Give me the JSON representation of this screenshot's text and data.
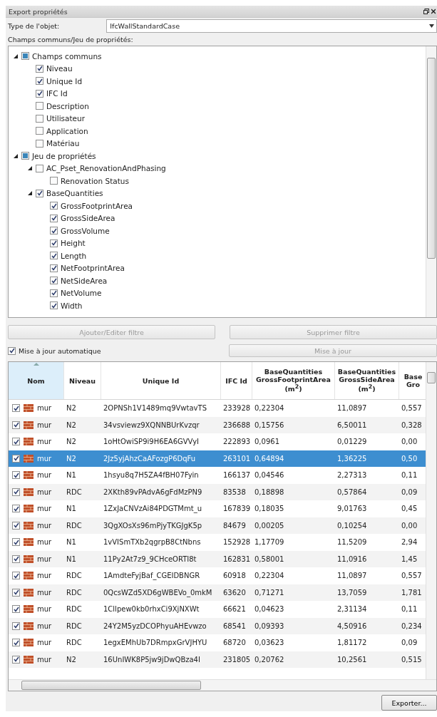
{
  "panel": {
    "title": "Export propriétés"
  },
  "object_type": {
    "label": "Type de l'objet:",
    "value": "IfcWallStandardCase"
  },
  "tree_label": "Champs communs/Jeu de propriétés:",
  "tree": [
    {
      "label": "Champs communs",
      "checked": false,
      "indeterminate": true,
      "expanded": true,
      "children": [
        {
          "label": "Niveau",
          "checked": true
        },
        {
          "label": "Unique Id",
          "checked": true
        },
        {
          "label": "IFC Id",
          "checked": true
        },
        {
          "label": "Description",
          "checked": false
        },
        {
          "label": "Utilisateur",
          "checked": false
        },
        {
          "label": "Application",
          "checked": false
        },
        {
          "label": "Matériau",
          "checked": false
        }
      ]
    },
    {
      "label": "Jeu de propriétés",
      "checked": false,
      "indeterminate": true,
      "expanded": true,
      "children": [
        {
          "label": "AC_Pset_RenovationAndPhasing",
          "checked": false,
          "indeterminate": false,
          "expanded": true,
          "children": [
            {
              "label": "Renovation Status",
              "checked": false
            }
          ]
        },
        {
          "label": "BaseQuantities",
          "checked": true,
          "indeterminate": false,
          "expanded": true,
          "children": [
            {
              "label": "GrossFootprintArea",
              "checked": true
            },
            {
              "label": "GrossSideArea",
              "checked": true
            },
            {
              "label": "GrossVolume",
              "checked": true
            },
            {
              "label": "Height",
              "checked": true
            },
            {
              "label": "Length",
              "checked": true
            },
            {
              "label": "NetFootprintArea",
              "checked": true
            },
            {
              "label": "NetSideArea",
              "checked": true
            },
            {
              "label": "NetVolume",
              "checked": true
            },
            {
              "label": "Width",
              "checked": true
            }
          ]
        }
      ]
    }
  ],
  "filter_buttons": [
    {
      "label": "Ajouter/Editer filtre",
      "disabled": true
    },
    {
      "label": "Supprimer filtre",
      "disabled": true
    }
  ],
  "auto_update": {
    "label": "Mise à jour automatique",
    "checked": true
  },
  "update_button": {
    "label": "Mise à jour",
    "disabled": true
  },
  "table": {
    "columns": [
      {
        "lines": [
          "Nom"
        ],
        "sorted": true
      },
      {
        "lines": [
          "Niveau"
        ],
        "sorted": false
      },
      {
        "lines": [
          "Unique Id"
        ],
        "sorted": false
      },
      {
        "lines": [
          "IFC Id"
        ],
        "sorted": false
      },
      {
        "lines": [
          "BaseQuantities",
          "GrossFootprintArea",
          "(m$^{2}$)"
        ],
        "sorted": false
      },
      {
        "lines": [
          "BaseQuantities",
          "GrossSideArea",
          "(m$^{2}$)"
        ],
        "sorted": false
      },
      {
        "lines": [
          "Base",
          "Gro"
        ],
        "sorted": false
      }
    ],
    "rows": [
      {
        "checked": true,
        "selected": false,
        "cells": [
          "mur",
          "N2",
          "2OPNSh1V1489mq9VwtavTS",
          "233928",
          "0,22304",
          "11,0897",
          "0,557"
        ]
      },
      {
        "checked": true,
        "selected": false,
        "cells": [
          "mur",
          "N2",
          "34vsviewz9XQNNBUrKvzqr",
          "236688",
          "0,15756",
          "6,50011",
          "0,328"
        ]
      },
      {
        "checked": true,
        "selected": false,
        "cells": [
          "mur",
          "N2",
          "1oHtOwiSP9i9H6EA6GVVyI",
          "222893",
          "0,0961",
          "0,01229",
          "0,00"
        ]
      },
      {
        "checked": true,
        "selected": true,
        "cells": [
          "mur",
          "N2",
          "2Jz5yjAhzCaAFozgP6DqFu",
          "263101",
          "0,64894",
          "1,36225",
          "0,50"
        ]
      },
      {
        "checked": true,
        "selected": false,
        "cells": [
          "mur",
          "N1",
          "1hsyu8q7H5ZA4fBH07Fyin",
          "166137",
          "0,04546",
          "2,27313",
          "0,11"
        ]
      },
      {
        "checked": true,
        "selected": false,
        "cells": [
          "mur",
          "RDC",
          "2XKth89vPAdvA6gFdMzPN9",
          "83538",
          "0,18898",
          "0,57864",
          "0,09"
        ]
      },
      {
        "checked": true,
        "selected": false,
        "cells": [
          "mur",
          "N1",
          "1ZxJaCNVzAi84PDGTMmt_u",
          "167839",
          "0,18035",
          "9,01763",
          "0,45"
        ]
      },
      {
        "checked": true,
        "selected": false,
        "cells": [
          "mur",
          "RDC",
          "3QgXOsXs96mPjyTKGJgK5p",
          "84679",
          "0,00205",
          "0,10254",
          "0,00"
        ]
      },
      {
        "checked": true,
        "selected": false,
        "cells": [
          "mur",
          "N1",
          "1vVISmTXb2qgrpB8CtNbns",
          "152928",
          "1,17709",
          "11,5209",
          "2,94"
        ]
      },
      {
        "checked": true,
        "selected": false,
        "cells": [
          "mur",
          "N1",
          "11Py2At7z9_9CHceORTI8t",
          "162831",
          "0,58001",
          "11,0916",
          "1,45"
        ]
      },
      {
        "checked": true,
        "selected": false,
        "cells": [
          "mur",
          "RDC",
          "1AmdteFyjBaf_CGEIDBNGR",
          "60918",
          "0,22304",
          "11,0897",
          "0,557"
        ]
      },
      {
        "checked": true,
        "selected": false,
        "cells": [
          "mur",
          "RDC",
          "0QcsWZd5XD6gWBEVo_0mkM",
          "63620",
          "0,71271",
          "13,7059",
          "1,781"
        ]
      },
      {
        "checked": true,
        "selected": false,
        "cells": [
          "mur",
          "RDC",
          "1Cllpew0kb0rhxCi9XjNXWt",
          "66621",
          "0,04623",
          "2,31134",
          "0,11"
        ]
      },
      {
        "checked": true,
        "selected": false,
        "cells": [
          "mur",
          "RDC",
          "24Y2M5yzDCOPhyuAHEvwzo",
          "68541",
          "0,09393",
          "4,50916",
          "0,234"
        ]
      },
      {
        "checked": true,
        "selected": false,
        "cells": [
          "mur",
          "RDC",
          "1egxEMhUb7DRmpxGrVJHYU",
          "68720",
          "0,03623",
          "1,81172",
          "0,09"
        ]
      },
      {
        "checked": true,
        "selected": false,
        "cells": [
          "mur",
          "N2",
          "16UnIWK8P5jw9jDwQBza4I",
          "231805",
          "0,20762",
          "10,2561",
          "0,515"
        ]
      }
    ]
  },
  "export_button": {
    "label": "Exporter..."
  }
}
